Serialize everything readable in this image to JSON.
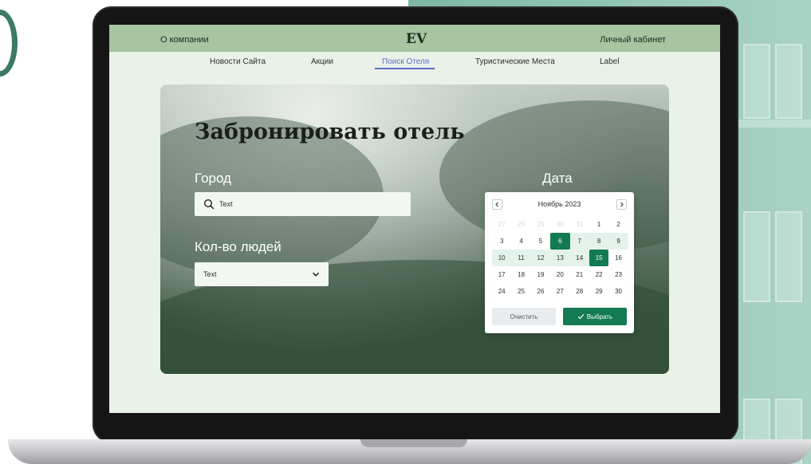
{
  "header": {
    "about_link": "О компании",
    "logo": "EV",
    "account_link": "Личный кабинет"
  },
  "nav": {
    "items": [
      {
        "label": "Новости Сайта"
      },
      {
        "label": "Акции"
      },
      {
        "label": "Поиск Отеля",
        "active": true
      },
      {
        "label": "Туристические Места"
      },
      {
        "label": "Label"
      }
    ]
  },
  "hero": {
    "title": "Забронировать отель",
    "city_label": "Город",
    "city_value": "Text",
    "people_label": "Кол-во людей",
    "people_value": "Text",
    "date_label": "Дата"
  },
  "calendar": {
    "month": "Ноябрь 2023",
    "weeks": [
      [
        "27",
        "28",
        "29",
        "30",
        "31",
        "1",
        "2"
      ],
      [
        "3",
        "4",
        "5",
        "6",
        "7",
        "8",
        "9"
      ],
      [
        "10",
        "11",
        "12",
        "13",
        "14",
        "15",
        "16"
      ],
      [
        "17",
        "18",
        "19",
        "20",
        "21",
        "22",
        "23"
      ],
      [
        "24",
        "25",
        "26",
        "27",
        "28",
        "29",
        "30"
      ]
    ],
    "selected_start": "6",
    "selected_end": "15",
    "clear_label": "Очистить",
    "choose_label": "Выбрать"
  },
  "colors": {
    "accent": "#137a54",
    "header_bg": "#a7c5a0",
    "nav_active": "#5a6fc8"
  }
}
